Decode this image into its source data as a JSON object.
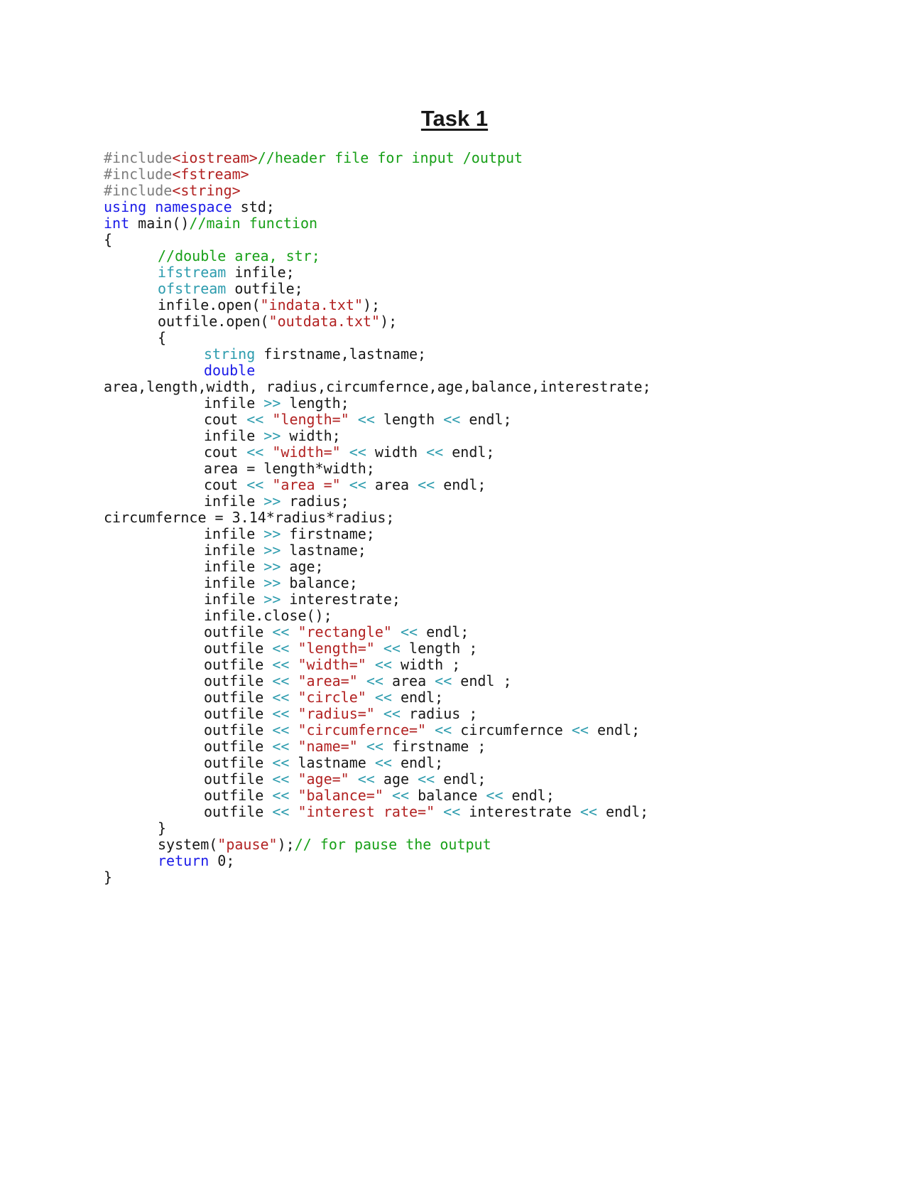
{
  "page": {
    "title": "Task 1",
    "background": "#ffffff"
  },
  "colors": {
    "page-bg": "#ffffff",
    "plain": "#171717",
    "preprocessor": "#7d7d7d",
    "header": "#b22222",
    "string": "#b22222",
    "comment": "#18a018",
    "keyword": "#1a1ae8",
    "type": "#2d9cae",
    "operator": "#2d9cae"
  },
  "code": {
    "lines": [
      {
        "indent": 0,
        "segments": [
          [
            "pre",
            "#include"
          ],
          [
            "hdr",
            "<iostream>"
          ],
          [
            "com",
            "//header file for input /output"
          ]
        ]
      },
      {
        "indent": 0,
        "segments": [
          [
            "pre",
            "#include"
          ],
          [
            "hdr",
            "<fstream>"
          ]
        ]
      },
      {
        "indent": 0,
        "segments": [
          [
            "pre",
            "#include"
          ],
          [
            "hdr",
            "<string>"
          ]
        ]
      },
      {
        "indent": 0,
        "segments": [
          [
            "kw",
            "using namespace"
          ],
          [
            "pln",
            " std;"
          ]
        ]
      },
      {
        "indent": 0,
        "segments": [
          [
            "kw",
            "int"
          ],
          [
            "pln",
            " main()"
          ],
          [
            "com",
            "//main function"
          ]
        ]
      },
      {
        "indent": 0,
        "segments": [
          [
            "pln",
            "{"
          ]
        ]
      },
      {
        "indent": 1,
        "segments": [
          [
            "com",
            "//double area, str;"
          ]
        ]
      },
      {
        "indent": 1,
        "segments": [
          [
            "typ",
            "ifstream"
          ],
          [
            "pln",
            " infile;"
          ]
        ]
      },
      {
        "indent": 1,
        "segments": [
          [
            "typ",
            "ofstream"
          ],
          [
            "pln",
            " outfile;"
          ]
        ]
      },
      {
        "indent": 1,
        "segments": [
          [
            "pln",
            "infile.open("
          ],
          [
            "str",
            "\"indata.txt\""
          ],
          [
            "pln",
            ");"
          ]
        ]
      },
      {
        "indent": 1,
        "segments": [
          [
            "pln",
            "outfile.open("
          ],
          [
            "str",
            "\"outdata.txt\""
          ],
          [
            "pln",
            ");"
          ]
        ]
      },
      {
        "indent": 1,
        "segments": [
          [
            "pln",
            "{"
          ]
        ]
      },
      {
        "indent": 2,
        "segments": [
          [
            "typ",
            "string"
          ],
          [
            "pln",
            " firstname,lastname;"
          ]
        ]
      },
      {
        "indent": 2,
        "segments": [
          [
            "kw",
            "double"
          ]
        ]
      },
      {
        "indent": 0,
        "segments": [
          [
            "pln",
            "area,length,width, radius,circumfernce,age,balance,interestrate;"
          ]
        ]
      },
      {
        "indent": 2,
        "segments": [
          [
            "pln",
            "infile "
          ],
          [
            "op",
            ">>"
          ],
          [
            "pln",
            " length;"
          ]
        ]
      },
      {
        "indent": 2,
        "segments": [
          [
            "pln",
            "cout "
          ],
          [
            "op",
            "<<"
          ],
          [
            "pln",
            " "
          ],
          [
            "str",
            "\"length=\""
          ],
          [
            "pln",
            " "
          ],
          [
            "op",
            "<<"
          ],
          [
            "pln",
            " length "
          ],
          [
            "op",
            "<<"
          ],
          [
            "pln",
            " endl;"
          ]
        ]
      },
      {
        "indent": 2,
        "segments": [
          [
            "pln",
            "infile "
          ],
          [
            "op",
            ">>"
          ],
          [
            "pln",
            " width;"
          ]
        ]
      },
      {
        "indent": 2,
        "segments": [
          [
            "pln",
            "cout "
          ],
          [
            "op",
            "<<"
          ],
          [
            "pln",
            " "
          ],
          [
            "str",
            "\"width=\""
          ],
          [
            "pln",
            " "
          ],
          [
            "op",
            "<<"
          ],
          [
            "pln",
            " width "
          ],
          [
            "op",
            "<<"
          ],
          [
            "pln",
            " endl;"
          ]
        ]
      },
      {
        "indent": 2,
        "segments": [
          [
            "pln",
            "area = length*width;"
          ]
        ]
      },
      {
        "indent": 2,
        "segments": [
          [
            "pln",
            "cout "
          ],
          [
            "op",
            "<<"
          ],
          [
            "pln",
            " "
          ],
          [
            "str",
            "\"area =\""
          ],
          [
            "pln",
            " "
          ],
          [
            "op",
            "<<"
          ],
          [
            "pln",
            " area "
          ],
          [
            "op",
            "<<"
          ],
          [
            "pln",
            " endl;"
          ]
        ]
      },
      {
        "indent": 2,
        "segments": [
          [
            "pln",
            "infile "
          ],
          [
            "op",
            ">>"
          ],
          [
            "pln",
            " radius;"
          ]
        ]
      },
      {
        "indent": 0,
        "segments": [
          [
            "pln",
            "circumfernce = 3.14*radius*radius;"
          ]
        ]
      },
      {
        "indent": 2,
        "segments": [
          [
            "pln",
            "infile "
          ],
          [
            "op",
            ">>"
          ],
          [
            "pln",
            " firstname;"
          ]
        ]
      },
      {
        "indent": 2,
        "segments": [
          [
            "pln",
            "infile "
          ],
          [
            "op",
            ">>"
          ],
          [
            "pln",
            " lastname;"
          ]
        ]
      },
      {
        "indent": 2,
        "segments": [
          [
            "pln",
            "infile "
          ],
          [
            "op",
            ">>"
          ],
          [
            "pln",
            " age;"
          ]
        ]
      },
      {
        "indent": 2,
        "segments": [
          [
            "pln",
            "infile "
          ],
          [
            "op",
            ">>"
          ],
          [
            "pln",
            " balance;"
          ]
        ]
      },
      {
        "indent": 2,
        "segments": [
          [
            "pln",
            "infile "
          ],
          [
            "op",
            ">>"
          ],
          [
            "pln",
            " interestrate;"
          ]
        ]
      },
      {
        "indent": 2,
        "segments": [
          [
            "pln",
            "infile.close();"
          ]
        ]
      },
      {
        "indent": 2,
        "segments": [
          [
            "pln",
            "outfile "
          ],
          [
            "op",
            "<<"
          ],
          [
            "pln",
            " "
          ],
          [
            "str",
            "\"rectangle\""
          ],
          [
            "pln",
            " "
          ],
          [
            "op",
            "<<"
          ],
          [
            "pln",
            " endl;"
          ]
        ]
      },
      {
        "indent": 2,
        "segments": [
          [
            "pln",
            "outfile "
          ],
          [
            "op",
            "<<"
          ],
          [
            "pln",
            " "
          ],
          [
            "str",
            "\"length=\""
          ],
          [
            "pln",
            " "
          ],
          [
            "op",
            "<<"
          ],
          [
            "pln",
            " length ;"
          ]
        ]
      },
      {
        "indent": 2,
        "segments": [
          [
            "pln",
            "outfile "
          ],
          [
            "op",
            "<<"
          ],
          [
            "pln",
            " "
          ],
          [
            "str",
            "\"width=\""
          ],
          [
            "pln",
            " "
          ],
          [
            "op",
            "<<"
          ],
          [
            "pln",
            " width ;"
          ]
        ]
      },
      {
        "indent": 2,
        "segments": [
          [
            "pln",
            "outfile "
          ],
          [
            "op",
            "<<"
          ],
          [
            "pln",
            " "
          ],
          [
            "str",
            "\"area=\""
          ],
          [
            "pln",
            " "
          ],
          [
            "op",
            "<<"
          ],
          [
            "pln",
            " area "
          ],
          [
            "op",
            "<<"
          ],
          [
            "pln",
            " endl ;"
          ]
        ]
      },
      {
        "indent": 2,
        "segments": [
          [
            "pln",
            "outfile "
          ],
          [
            "op",
            "<<"
          ],
          [
            "pln",
            " "
          ],
          [
            "str",
            "\"circle\""
          ],
          [
            "pln",
            " "
          ],
          [
            "op",
            "<<"
          ],
          [
            "pln",
            " endl;"
          ]
        ]
      },
      {
        "indent": 2,
        "segments": [
          [
            "pln",
            "outfile "
          ],
          [
            "op",
            "<<"
          ],
          [
            "pln",
            " "
          ],
          [
            "str",
            "\"radius=\""
          ],
          [
            "pln",
            " "
          ],
          [
            "op",
            "<<"
          ],
          [
            "pln",
            " radius ;"
          ]
        ]
      },
      {
        "indent": 2,
        "segments": [
          [
            "pln",
            "outfile "
          ],
          [
            "op",
            "<<"
          ],
          [
            "pln",
            " "
          ],
          [
            "str",
            "\"circumfernce=\""
          ],
          [
            "pln",
            " "
          ],
          [
            "op",
            "<<"
          ],
          [
            "pln",
            " circumfernce "
          ],
          [
            "op",
            "<<"
          ],
          [
            "pln",
            " endl;"
          ]
        ]
      },
      {
        "indent": 2,
        "segments": [
          [
            "pln",
            "outfile "
          ],
          [
            "op",
            "<<"
          ],
          [
            "pln",
            " "
          ],
          [
            "str",
            "\"name=\""
          ],
          [
            "pln",
            " "
          ],
          [
            "op",
            "<<"
          ],
          [
            "pln",
            " firstname ;"
          ]
        ]
      },
      {
        "indent": 2,
        "segments": [
          [
            "pln",
            "outfile "
          ],
          [
            "op",
            "<<"
          ],
          [
            "pln",
            " lastname "
          ],
          [
            "op",
            "<<"
          ],
          [
            "pln",
            " endl;"
          ]
        ]
      },
      {
        "indent": 2,
        "segments": [
          [
            "pln",
            "outfile "
          ],
          [
            "op",
            "<<"
          ],
          [
            "pln",
            " "
          ],
          [
            "str",
            "\"age=\""
          ],
          [
            "pln",
            " "
          ],
          [
            "op",
            "<<"
          ],
          [
            "pln",
            " age "
          ],
          [
            "op",
            "<<"
          ],
          [
            "pln",
            " endl;"
          ]
        ]
      },
      {
        "indent": 2,
        "segments": [
          [
            "pln",
            "outfile "
          ],
          [
            "op",
            "<<"
          ],
          [
            "pln",
            " "
          ],
          [
            "str",
            "\"balance=\""
          ],
          [
            "pln",
            " "
          ],
          [
            "op",
            "<<"
          ],
          [
            "pln",
            " balance "
          ],
          [
            "op",
            "<<"
          ],
          [
            "pln",
            " endl;"
          ]
        ]
      },
      {
        "indent": 2,
        "segments": [
          [
            "pln",
            "outfile "
          ],
          [
            "op",
            "<<"
          ],
          [
            "pln",
            " "
          ],
          [
            "str",
            "\"interest rate=\""
          ],
          [
            "pln",
            " "
          ],
          [
            "op",
            "<<"
          ],
          [
            "pln",
            " interestrate "
          ],
          [
            "op",
            "<<"
          ],
          [
            "pln",
            " endl;"
          ]
        ]
      },
      {
        "indent": 1,
        "segments": [
          [
            "pln",
            "}"
          ]
        ]
      },
      {
        "indent": 1,
        "segments": [
          [
            "pln",
            "system("
          ],
          [
            "str",
            "\"pause\""
          ],
          [
            "pln",
            ");"
          ],
          [
            "com",
            "// for pause the output"
          ]
        ]
      },
      {
        "indent": 1,
        "segments": [
          [
            "kw",
            "return"
          ],
          [
            "pln",
            " 0;"
          ]
        ]
      },
      {
        "indent": 0,
        "segments": [
          [
            "pln",
            "}"
          ]
        ]
      }
    ]
  }
}
